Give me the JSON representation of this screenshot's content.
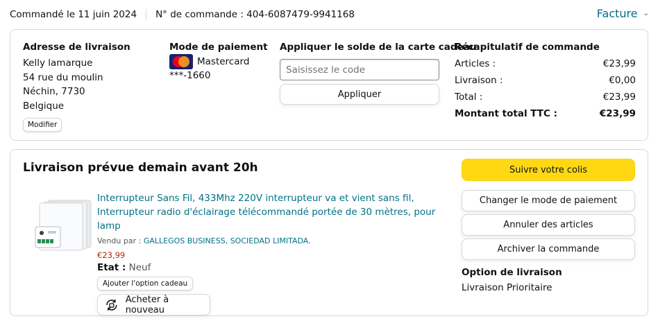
{
  "header": {
    "order_date": "Commandé le 11 juin 2024",
    "order_number": "N° de commande : 404-6087479-9941168",
    "invoice_label": "Facture"
  },
  "shipping_address": {
    "title": "Adresse de livraison",
    "lines": [
      "Kelly lamarque",
      "54 rue du moulin",
      "Néchin, 7730",
      "Belgique"
    ],
    "edit_label": "Modifier"
  },
  "payment": {
    "title": "Mode de paiement",
    "card_brand": "Mastercard",
    "card_number": "***-1660",
    "logo_icon": "mastercard-icon"
  },
  "gift_card": {
    "title": "Appliquer le solde de la carte cadeau",
    "placeholder": "Saisissez le code",
    "apply_label": "Appliquer"
  },
  "summary": {
    "title": "Récapitulatif de commande",
    "rows": [
      {
        "label": "Articles :",
        "value": "€23,99"
      },
      {
        "label": "Livraison :",
        "value": "€0,00"
      },
      {
        "label": "Total :",
        "value": "€23,99"
      },
      {
        "label": "Montant total TTC :",
        "value": "€23,99"
      }
    ]
  },
  "delivery": {
    "title": "Livraison prévue demain avant 20h",
    "product": {
      "title": "Interrupteur Sans Fil, 433Mhz 220V interrupteur va et vient sans fil, Interrupteur radio d'éclairage télécommandé portée de 30 mètres, pour lamp",
      "seller_prefix": "Vendu par : ",
      "seller_name": "GALLEGOS BUSINESS, SOCIEDAD LIMITADA.",
      "price": "€23,99",
      "condition_label": "Etat :",
      "condition_value": "Neuf",
      "gift_option_label": "Ajouter l'option cadeau",
      "buy_again_label": "Acheter à nouveau"
    },
    "actions": {
      "track": "Suivre votre colis",
      "change_payment": "Changer le mode de paiement",
      "cancel": "Annuler des articles",
      "archive": "Archiver la commande"
    },
    "shipping_option": {
      "title": "Option de livraison",
      "value": "Livraison Prioritaire"
    }
  },
  "colors": {
    "link": "#007185",
    "price": "#b12704",
    "primary_button": "#ffd814",
    "border": "#d5d9d9"
  }
}
